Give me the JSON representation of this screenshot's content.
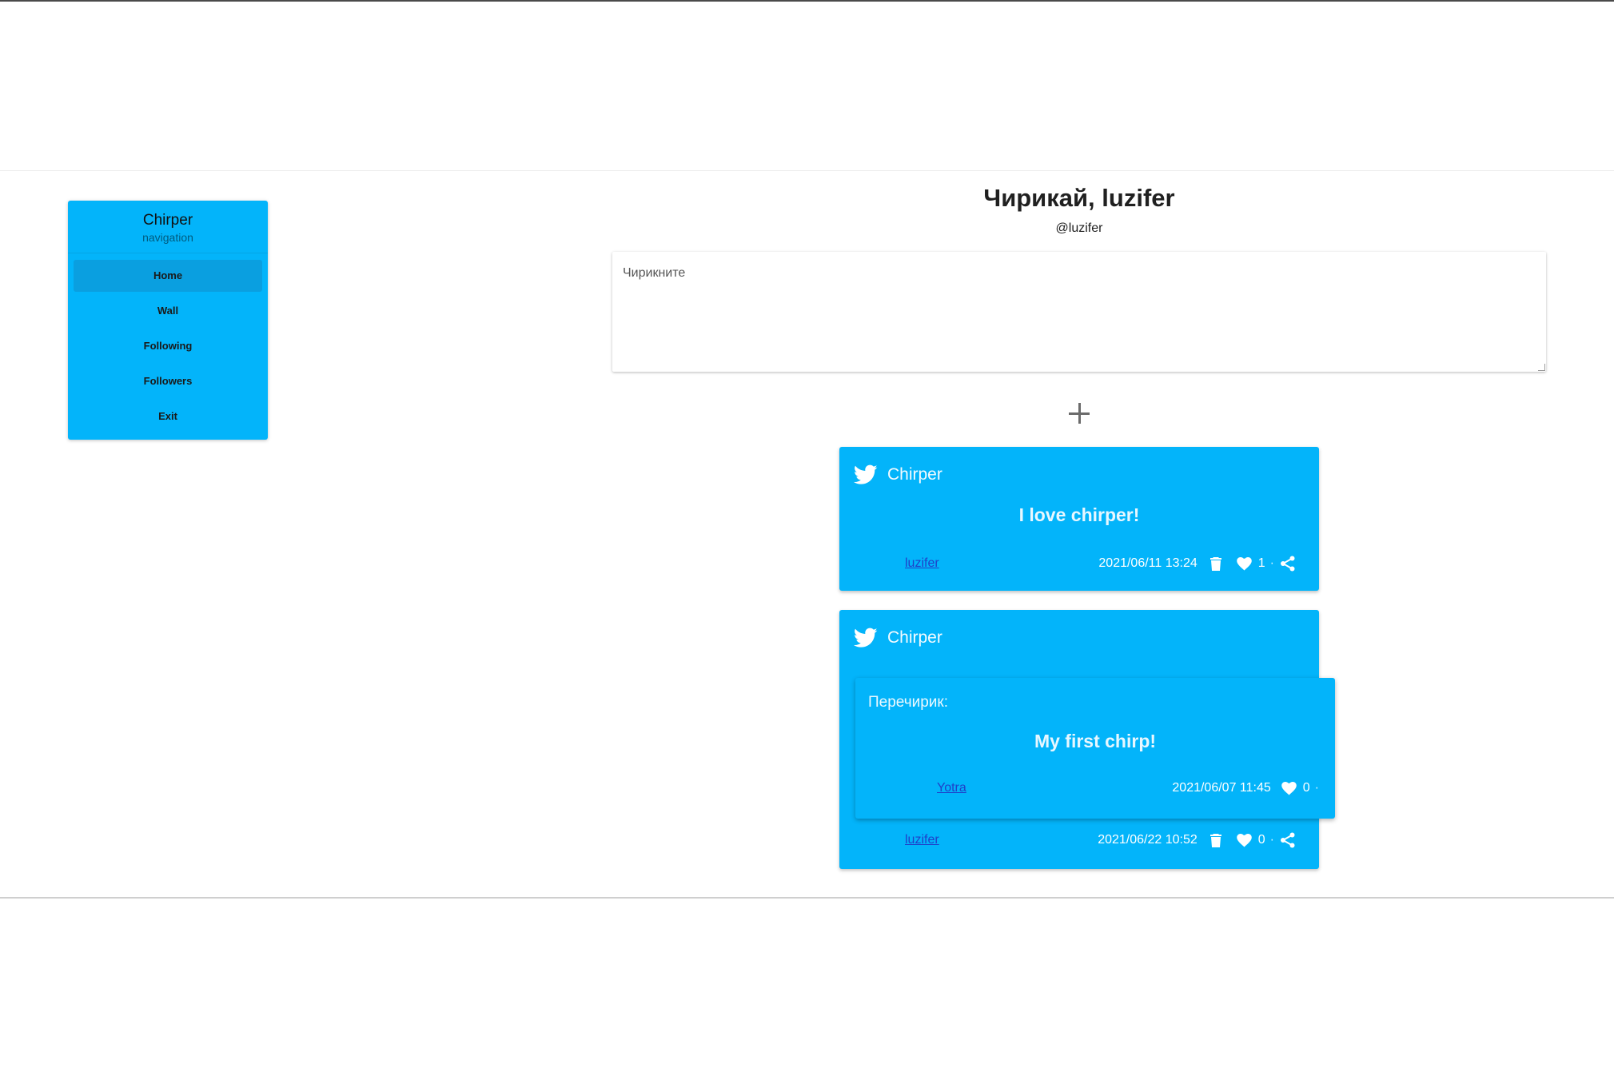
{
  "nav": {
    "title": "Chirper",
    "subtitle": "navigation",
    "items": [
      {
        "label": "Home"
      },
      {
        "label": "Wall"
      },
      {
        "label": "Following"
      },
      {
        "label": "Followers"
      },
      {
        "label": "Exit"
      }
    ]
  },
  "header": {
    "greeting": "Чирикай, luzifer",
    "handle": "@luzifer"
  },
  "compose": {
    "placeholder": "Чирикните"
  },
  "chirps": [
    {
      "brand": "Chirper",
      "text": "I love chirper!",
      "author": "luzifer",
      "date": "2021/06/11 13:24",
      "likes": "1",
      "separator": "·"
    },
    {
      "brand": "Chirper",
      "rechirp": {
        "label": "Перечирик:",
        "text": "My first chirp!",
        "author": "Yotra",
        "date": "2021/06/07 11:45",
        "likes": "0",
        "separator": "·"
      },
      "author": "luzifer",
      "date": "2021/06/22 10:52",
      "likes": "0",
      "separator": "·"
    }
  ],
  "colors": {
    "card": "#03b4fa",
    "nav_active": "#0a9fe0",
    "link": "#2040c8"
  },
  "icons": {
    "bird": "twitter-bird-icon",
    "delete": "trash-icon",
    "like": "heart-icon",
    "share": "share-icon",
    "add": "plus-icon"
  }
}
